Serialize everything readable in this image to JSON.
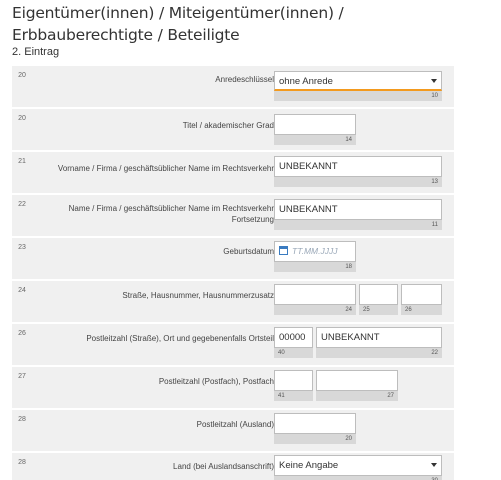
{
  "heading": {
    "title_line1": "Eigentümer(innen) / Miteigentümer(innen) /",
    "title_line2": "Erbbauberechtigte / Beteiligte",
    "subtitle": "2. Eintrag"
  },
  "rows": [
    {
      "num": "20",
      "label": "Anredeschlüssel",
      "value": "ohne Anrede",
      "counter": "10"
    },
    {
      "num": "20",
      "label": "Titel / akademischer Grad",
      "value": "",
      "counter": "14"
    },
    {
      "num": "21",
      "label": "Vorname / Firma / geschäftsüblicher Name im Rechtsverkehr",
      "value": "UNBEKANNT",
      "counter": "13"
    },
    {
      "num": "22",
      "label_line1": "Name / Firma / geschäftsüblicher Name im Rechtsverkehr",
      "label_line2": "Fortsetzung",
      "value": "UNBEKANNT",
      "counter": "11"
    },
    {
      "num": "23",
      "label": "Geburtsdatum",
      "placeholder": "TT.MM.JJJJ",
      "counter": "18"
    },
    {
      "num": "24",
      "label": "Straße,  Hausnummer,  Hausnummerzusatz",
      "counters": [
        "24",
        "25",
        "26"
      ]
    },
    {
      "num": "26",
      "label": "Postleitzahl (Straße),  Ort und gegebenenfalls Ortsteil",
      "plz": "00000",
      "ort": "UNBEKANNT",
      "counters": [
        "40",
        "22"
      ]
    },
    {
      "num": "27",
      "label": "Postleitzahl (Postfach),  Postfach",
      "counters": [
        "41",
        "27"
      ]
    },
    {
      "num": "28",
      "label": "Postleitzahl (Ausland)",
      "counter": "20"
    },
    {
      "num": "28",
      "label": "Land (bei Auslandsanschrift)",
      "value": "Keine Angabe",
      "counter": "30"
    }
  ]
}
